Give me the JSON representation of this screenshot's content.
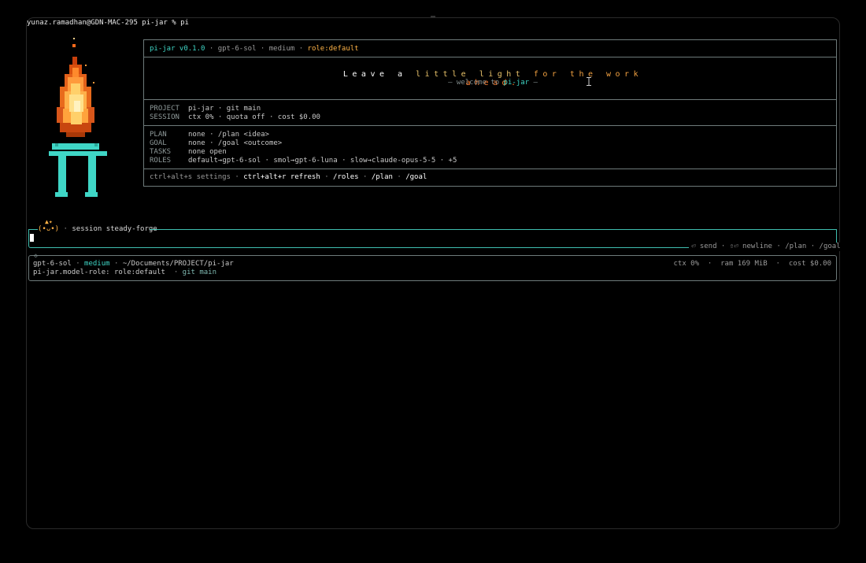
{
  "terminal": {
    "prompt": "yunaz.ramadhan@GDN-MAC-295 pi-jar % pi"
  },
  "header": {
    "app": "pi-jar v0.1.0",
    "sep": " · ",
    "model": "gpt-6-sol",
    "effort": "medium",
    "role": "role:default"
  },
  "tagline": {
    "part1": "Leave a ",
    "part2": "little light ",
    "part3": "for the work ",
    "part4": "ahead.",
    "welcome_prefix": "— welcome to ",
    "welcome_name": "pi-jar",
    "welcome_suffix": " —"
  },
  "info": {
    "project_key": "PROJECT",
    "project_val": "pi-jar · git main",
    "session_key": "SESSION",
    "session_val": "ctx 0% · quota off · cost $0.00",
    "plan_key": "PLAN",
    "plan_val": "none · /plan <idea>",
    "goal_key": "GOAL",
    "goal_val": "none · /goal <outcome>",
    "tasks_key": "TASKS",
    "tasks_val": "none open",
    "roles_key": "ROLES",
    "roles_val": "default→gpt-6-sol · smol→gpt-6-luna · slow→claude-opus-5-5 · +5"
  },
  "shortcuts": {
    "settings_key": "ctrl+alt+s",
    "settings_label": "settings",
    "refresh": "ctrl+alt+r refresh",
    "roles": "/roles",
    "plan": "/plan",
    "goal": "/goal",
    "sep": " · "
  },
  "session": {
    "face": "(•ᴗ•)",
    "ears": "▲✦",
    "label": "session steady-forge",
    "hints": "⏎ send · ⇧⏎ newline · /plan · /goal"
  },
  "statusbar": {
    "model": "gpt-6-sol",
    "effort": "medium",
    "path": "~/Documents/PROJECT/pi-jar",
    "ctx": "ctx 0%",
    "ram": "ram 169 MiB",
    "cost": "cost $0.00",
    "role_line": "pi-jar.model-role: role:default",
    "git": "git main",
    "sep": " · "
  },
  "colors": {
    "accent_teal": "#3fd6c6",
    "accent_orange": "#ffb347",
    "flame": "#ff8a1c",
    "background": "#000000"
  }
}
